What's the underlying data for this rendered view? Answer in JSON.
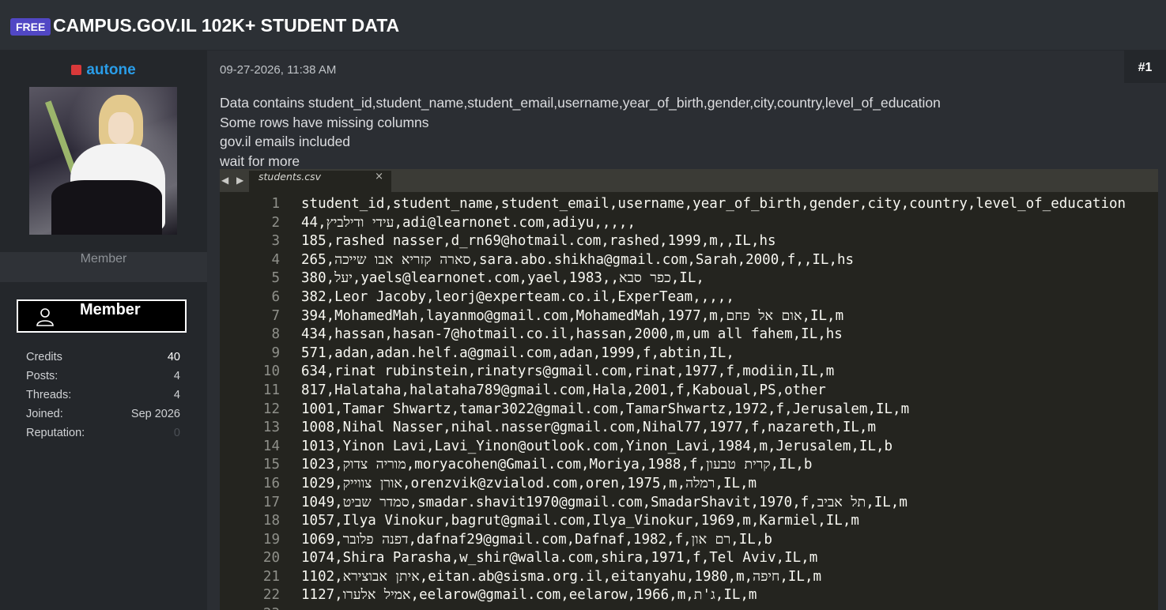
{
  "thread": {
    "badge": "FREE",
    "title": "CAMPUS.GOV.IL 102K+ STUDENT DATA"
  },
  "author": {
    "username": "autone",
    "status_color": "#d9393a",
    "role": "Member",
    "badge_label": "Member",
    "stats": [
      {
        "label": "Credits",
        "value": "40"
      },
      {
        "label": "Posts:",
        "value": "4"
      },
      {
        "label": "Threads:",
        "value": "4"
      },
      {
        "label": "Joined:",
        "value": "Sep 2026"
      },
      {
        "label": "Reputation:",
        "value": "0"
      }
    ]
  },
  "post": {
    "date": "09-27-2026, 11:38 AM",
    "number": "#1",
    "message": [
      "Data contains student_id,student_name,student_email,username,year_of_birth,gender,city,country,level_of_education",
      "Some rows have missing columns",
      "gov.il emails included",
      "wait for more"
    ]
  },
  "editor": {
    "nav": "◀ ▶",
    "tab_name": "students.csv",
    "tab_close": "×",
    "lines": [
      {
        "n": "1",
        "t": "student_id,student_name,student_email,username,year_of_birth,gender,city,country,level_of_education"
      },
      {
        "n": "2",
        "t": "44,עידי ודילביץ,adi@learnonet.com,adiyu,,,,,"
      },
      {
        "n": "3",
        "t": "185,rashed nasser,d_rn69@hotmail.com,rashed,1999,m,,IL,hs"
      },
      {
        "n": "4",
        "t": "265,סארה קזריא אבו שייכה,sara.abo.shikha@gmail.com,Sarah,2000,f,,IL,hs"
      },
      {
        "n": "5",
        "t": "380,יעל,yaels@learnonet.com,yael,1983,,כפר סבא,IL,"
      },
      {
        "n": "6",
        "t": "382,Leor Jacoby,leorj@experteam.co.il,ExperTeam,,,,,"
      },
      {
        "n": "7",
        "t": "394,MohamedMah,layanmo@gmail.com,MohamedMah,1977,m,אום אל פחם,IL,m"
      },
      {
        "n": "8",
        "t": "434,hassan,hasan-7@hotmail.co.il,hassan,2000,m,um all fahem,IL,hs"
      },
      {
        "n": "9",
        "t": "571,adan,adan.helf.a@gmail.com,adan,1999,f,abtin,IL,"
      },
      {
        "n": "10",
        "t": "634,rinat rubinstein,rinatyrs@gmail.com,rinat,1977,f,modiin,IL,m"
      },
      {
        "n": "11",
        "t": "817,Halataha,halataha789@gmail.com,Hala,2001,f,Kaboual,PS,other"
      },
      {
        "n": "12",
        "t": "1001,Tamar Shwartz,tamar3022@gmail.com,TamarShwartz,1972,f,Jerusalem,IL,m"
      },
      {
        "n": "13",
        "t": "1008,Nihal Nasser,nihal.nasser@gmail.com,Nihal77,1977,f,nazareth,IL,m"
      },
      {
        "n": "14",
        "t": "1013,Yinon Lavi,Lavi_Yinon@outlook.com,Yinon_Lavi,1984,m,Jerusalem,IL,b"
      },
      {
        "n": "15",
        "t": "1023,מוריה צדוק,moryacohen@Gmail.com,Moriya,1988,f,קרית טבעון,IL,b"
      },
      {
        "n": "16",
        "t": "1029,אורן צווייק,orenzvik@zvialod.com,oren,1975,m,רמלה,IL,m"
      },
      {
        "n": "17",
        "t": "1049,סמדר שביט,smadar.shavit1970@gmail.com,SmadarShavit,1970,f,תל אביב,IL,m"
      },
      {
        "n": "18",
        "t": "1057,Ilya Vinokur,bagrut@gmail.com,Ilya_Vinokur,1969,m,Karmiel,IL,m"
      },
      {
        "n": "19",
        "t": "1069,דפנה פלובר,dafnaf29@gmail.com,Dafnaf,1982,f,רם און,IL,b"
      },
      {
        "n": "20",
        "t": "1074,Shira Parasha,w_shir@walla.com,shira,1971,f,Tel Aviv,IL,m"
      },
      {
        "n": "21",
        "t": "1102,איתן אבוצירא,eitan.ab@sisma.org.il,eitanyahu,1980,m,חיפה,IL,m"
      },
      {
        "n": "22",
        "t": "1127,אמיל אלערו,eelarow@gmail.com,eelarow,1966,m,ג'ת,IL,m"
      },
      {
        "n": "23",
        "t": ""
      }
    ]
  }
}
